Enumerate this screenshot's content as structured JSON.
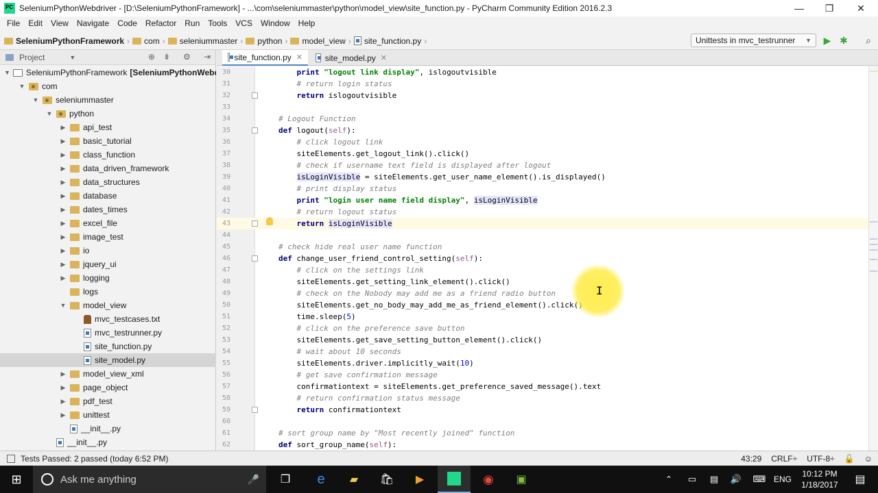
{
  "window": {
    "title": "SeleniumPythonWebdriver - [D:\\SeleniumPythonFramework] - ...\\com\\seleniummaster\\python\\model_view\\site_function.py - PyCharm Community Edition 2016.2.3",
    "minimize": "—",
    "maximize": "❐",
    "close": "✕"
  },
  "menu": [
    "File",
    "Edit",
    "View",
    "Navigate",
    "Code",
    "Refactor",
    "Run",
    "Tools",
    "VCS",
    "Window",
    "Help"
  ],
  "breadcrumbs": [
    "SeleniumPythonFramework",
    "com",
    "seleniummaster",
    "python",
    "model_view",
    "site_function.py"
  ],
  "run_config": "Unittests in mvc_testrunner",
  "project_panel": {
    "title": "Project"
  },
  "tree": [
    {
      "label": "SeleniumPythonFramework",
      "bold_suffix": "[SeleniumPythonWebdr",
      "depth": 0,
      "icon": "modfolder",
      "arrow": "▼"
    },
    {
      "label": "com",
      "depth": 1,
      "icon": "pkg",
      "arrow": "▼"
    },
    {
      "label": "seleniummaster",
      "depth": 2,
      "icon": "pkg",
      "arrow": "▼"
    },
    {
      "label": "python",
      "depth": 3,
      "icon": "pkg",
      "arrow": "▼"
    },
    {
      "label": "api_test",
      "depth": 4,
      "icon": "folder",
      "arrow": "▶"
    },
    {
      "label": "basic_tutorial",
      "depth": 4,
      "icon": "folder",
      "arrow": "▶"
    },
    {
      "label": "class_function",
      "depth": 4,
      "icon": "folder",
      "arrow": "▶"
    },
    {
      "label": "data_driven_framework",
      "depth": 4,
      "icon": "folder",
      "arrow": "▶"
    },
    {
      "label": "data_structures",
      "depth": 4,
      "icon": "folder",
      "arrow": "▶"
    },
    {
      "label": "database",
      "depth": 4,
      "icon": "folder",
      "arrow": "▶"
    },
    {
      "label": "dates_times",
      "depth": 4,
      "icon": "folder",
      "arrow": "▶"
    },
    {
      "label": "excel_file",
      "depth": 4,
      "icon": "folder",
      "arrow": "▶"
    },
    {
      "label": "image_test",
      "depth": 4,
      "icon": "folder",
      "arrow": "▶"
    },
    {
      "label": "io",
      "depth": 4,
      "icon": "folder",
      "arrow": "▶"
    },
    {
      "label": "jquery_ui",
      "depth": 4,
      "icon": "folder",
      "arrow": "▶"
    },
    {
      "label": "logging",
      "depth": 4,
      "icon": "folder",
      "arrow": "▶"
    },
    {
      "label": "logs",
      "depth": 4,
      "icon": "folder",
      "arrow": ""
    },
    {
      "label": "model_view",
      "depth": 4,
      "icon": "folder",
      "arrow": "▼"
    },
    {
      "label": "mvc_testcases.txt",
      "depth": 5,
      "icon": "txt",
      "arrow": ""
    },
    {
      "label": "mvc_testrunner.py",
      "depth": 5,
      "icon": "py",
      "arrow": ""
    },
    {
      "label": "site_function.py",
      "depth": 5,
      "icon": "py",
      "arrow": ""
    },
    {
      "label": "site_model.py",
      "depth": 5,
      "icon": "py",
      "arrow": "",
      "selected": true
    },
    {
      "label": "model_view_xml",
      "depth": 4,
      "icon": "folder",
      "arrow": "▶"
    },
    {
      "label": "page_object",
      "depth": 4,
      "icon": "folder",
      "arrow": "▶"
    },
    {
      "label": "pdf_test",
      "depth": 4,
      "icon": "folder",
      "arrow": "▶"
    },
    {
      "label": "unittest",
      "depth": 4,
      "icon": "folder",
      "arrow": "▶"
    },
    {
      "label": "__init__.py",
      "depth": 4,
      "icon": "py",
      "arrow": ""
    },
    {
      "label": "__init__.py",
      "depth": 3,
      "icon": "py",
      "arrow": ""
    }
  ],
  "tabs": [
    {
      "label": "site_function.py",
      "active": true
    },
    {
      "label": "site_model.py",
      "active": false
    }
  ],
  "code": [
    {
      "n": "30",
      "t": [
        [
          "    ",
          ""
        ],
        [
          "print ",
          "kw"
        ],
        [
          "\"logout link display\"",
          "str"
        ],
        [
          ", islogoutvisible",
          ""
        ]
      ]
    },
    {
      "n": "31",
      "t": [
        [
          "    ",
          ""
        ],
        [
          "# return login status",
          "cmt"
        ]
      ]
    },
    {
      "n": "32",
      "t": [
        [
          "    ",
          ""
        ],
        [
          "return ",
          "kw"
        ],
        [
          "islogoutvisible",
          ""
        ]
      ]
    },
    {
      "n": "33",
      "t": []
    },
    {
      "n": "34",
      "t": [
        [
          "# Logout Function",
          "cmt"
        ]
      ]
    },
    {
      "n": "35",
      "t": [
        [
          "def ",
          "kw"
        ],
        [
          "logout(",
          ""
        ],
        [
          "self",
          "slf"
        ],
        [
          "):",
          ""
        ]
      ]
    },
    {
      "n": "36",
      "t": [
        [
          "    ",
          ""
        ],
        [
          "# click logout link",
          "cmt"
        ]
      ]
    },
    {
      "n": "37",
      "t": [
        [
          "    siteElements.get_logout_link().click()",
          ""
        ]
      ]
    },
    {
      "n": "38",
      "t": [
        [
          "    ",
          ""
        ],
        [
          "# check if username text field is displayed after logout",
          "cmt"
        ]
      ]
    },
    {
      "n": "39",
      "t": [
        [
          "    ",
          ""
        ],
        [
          "isLoginVisible",
          "hl"
        ],
        [
          " = siteElements.get_user_name_element().is_displayed()",
          ""
        ]
      ]
    },
    {
      "n": "40",
      "t": [
        [
          "    ",
          ""
        ],
        [
          "# print display status",
          "cmt"
        ]
      ]
    },
    {
      "n": "41",
      "t": [
        [
          "    ",
          ""
        ],
        [
          "print ",
          "kw"
        ],
        [
          "\"login user name field display\"",
          "str"
        ],
        [
          ", ",
          ""
        ],
        [
          "isLoginVisible",
          "hl"
        ]
      ]
    },
    {
      "n": "42",
      "t": [
        [
          "    ",
          ""
        ],
        [
          "# return logout status",
          "cmt"
        ]
      ]
    },
    {
      "n": "43",
      "t": [
        [
          "    ",
          ""
        ],
        [
          "return ",
          "kw"
        ],
        [
          "isLoginVisible",
          "hl"
        ]
      ],
      "current": true
    },
    {
      "n": "44",
      "t": []
    },
    {
      "n": "45",
      "t": [
        [
          "# check hide real user name function",
          "cmt"
        ]
      ]
    },
    {
      "n": "46",
      "t": [
        [
          "def ",
          "kw"
        ],
        [
          "change_user_friend_control_setting(",
          ""
        ],
        [
          "self",
          "slf"
        ],
        [
          "):",
          ""
        ]
      ]
    },
    {
      "n": "47",
      "t": [
        [
          "    ",
          ""
        ],
        [
          "# click on the settings link",
          "cmt"
        ]
      ]
    },
    {
      "n": "48",
      "t": [
        [
          "    siteElements.get_setting_link_element().click()",
          ""
        ]
      ]
    },
    {
      "n": "49",
      "t": [
        [
          "    ",
          ""
        ],
        [
          "# check on the Nobody may add me as a friend radio button",
          "cmt"
        ]
      ]
    },
    {
      "n": "50",
      "t": [
        [
          "    siteElements.get_no_body_may_add_me_as_friend_element().click()",
          ""
        ]
      ]
    },
    {
      "n": "51",
      "t": [
        [
          "    time.sleep(",
          ""
        ],
        [
          "5",
          "num"
        ],
        [
          ")",
          ""
        ]
      ]
    },
    {
      "n": "52",
      "t": [
        [
          "    ",
          ""
        ],
        [
          "# click on the preference save button",
          "cmt"
        ]
      ]
    },
    {
      "n": "53",
      "t": [
        [
          "    siteElements.get_save_setting_button_element().click()",
          ""
        ]
      ]
    },
    {
      "n": "54",
      "t": [
        [
          "    ",
          ""
        ],
        [
          "# wait about 10 seconds",
          "cmt"
        ]
      ]
    },
    {
      "n": "55",
      "t": [
        [
          "    siteElements.driver.implicitly_wait(",
          ""
        ],
        [
          "10",
          "num"
        ],
        [
          ")",
          ""
        ]
      ]
    },
    {
      "n": "56",
      "t": [
        [
          "    ",
          ""
        ],
        [
          "# get save confirmation message",
          "cmt"
        ]
      ]
    },
    {
      "n": "57",
      "t": [
        [
          "    confirmationtext = siteElements.get_preference_saved_message().text",
          ""
        ]
      ]
    },
    {
      "n": "58",
      "t": [
        [
          "    ",
          ""
        ],
        [
          "# return confirmation status message",
          "cmt"
        ]
      ]
    },
    {
      "n": "59",
      "t": [
        [
          "    ",
          ""
        ],
        [
          "return ",
          "kw"
        ],
        [
          "confirmationtext",
          ""
        ]
      ]
    },
    {
      "n": "60",
      "t": []
    },
    {
      "n": "61",
      "t": [
        [
          "# sort group name by \"Most recently joined\" function",
          "cmt"
        ]
      ]
    },
    {
      "n": "62",
      "t": [
        [
          "def ",
          "kw"
        ],
        [
          "sort_group_name(",
          ""
        ],
        [
          "self",
          "slf"
        ],
        [
          "):",
          ""
        ]
      ]
    }
  ],
  "status": {
    "message": "Tests Passed: 2 passed (today 6:52 PM)",
    "position": "43:29",
    "line_sep": "CRLF÷",
    "encoding": "UTF-8÷"
  },
  "taskbar": {
    "search_placeholder": "Ask me anything",
    "language": "ENG",
    "time": "10:12 PM",
    "date": "1/18/2017"
  },
  "colors": {
    "keyword": "#000080",
    "string": "#008000",
    "comment": "#808080",
    "accent": "#4a88c7"
  }
}
